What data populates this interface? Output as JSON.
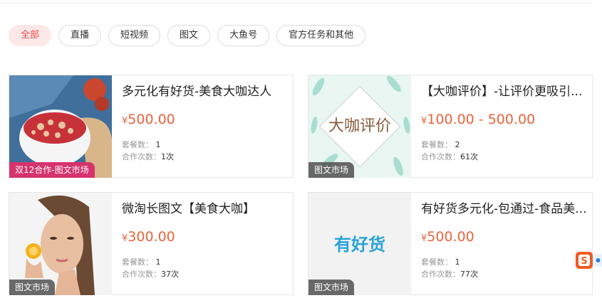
{
  "filters": [
    "全部",
    "直播",
    "短视频",
    "图文",
    "大鱼号",
    "官方任务和其他"
  ],
  "active_filter": "全部",
  "currency_symbol": "¥",
  "labels": {
    "package_count": "套餐数：",
    "coop_count": "合作次数："
  },
  "cards": [
    {
      "title": "多元化有好货-美食大咖达人",
      "price": "500.00",
      "package_count": "1",
      "coop_count": "1次",
      "tag": "双12合作-图文市场",
      "thumb": "food-bowl"
    },
    {
      "title": "【大咖评价】-让评价更吸引...",
      "price": "100.00 - 500.00",
      "package_count": "2",
      "coop_count": "61次",
      "tag": "图文市场",
      "thumb": "dakapingjia",
      "thumb_text": "大咖评价"
    },
    {
      "title": "微淘长图文【美食大咖】",
      "price": "300.00",
      "package_count": "1",
      "coop_count": "37次",
      "tag": "图文市场",
      "thumb": "woman-portrait"
    },
    {
      "title": "有好货多元化-包通过-食品美...",
      "price": "500.00",
      "package_count": "1",
      "coop_count": "77次",
      "tag": "图文市场",
      "thumb": "youhaohuo",
      "thumb_text": "有好货"
    }
  ],
  "colors": {
    "accent": "#e84a4a",
    "price": "#e8643c",
    "tag_bg": "#505050",
    "promo_tag_bg": "#d6336c",
    "chip_active_bg": "#fde8e8",
    "logo_blue": "#29a3d9",
    "floater": "#ef5a24"
  },
  "floater": {
    "icon": "sogou-input-icon",
    "glyph": "S"
  }
}
